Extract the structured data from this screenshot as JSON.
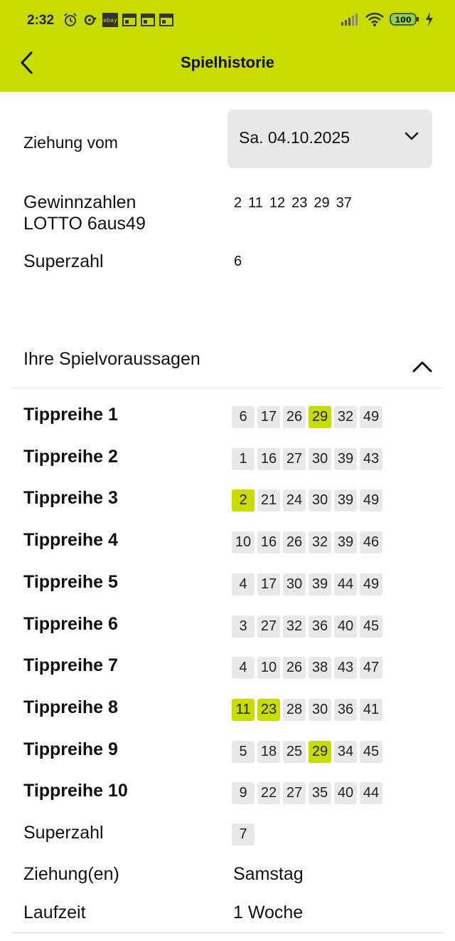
{
  "status_bar": {
    "time": "2:32",
    "battery": "100"
  },
  "app_bar": {
    "title": "Spielhistorie",
    "back_icon": "chevron-left-icon"
  },
  "draw": {
    "date_label": "Ziehung vom",
    "date_value": "Sa. 04.10.2025",
    "winning_label_line1": "Gewinnzahlen",
    "winning_label_line2": "LOTTO 6aus49",
    "winning_numbers": [
      "2",
      "11",
      "12",
      "23",
      "29",
      "37"
    ],
    "superzahl_label": "Superzahl",
    "superzahl_value": "6"
  },
  "predictions": {
    "title": "Ihre Spielvoraussagen",
    "rows": [
      {
        "label": "Tippreihe 1",
        "numbers": [
          "6",
          "17",
          "26",
          "29",
          "32",
          "49"
        ],
        "hits": [
          false,
          false,
          false,
          true,
          false,
          false
        ]
      },
      {
        "label": "Tippreihe 2",
        "numbers": [
          "1",
          "16",
          "27",
          "30",
          "39",
          "43"
        ],
        "hits": [
          false,
          false,
          false,
          false,
          false,
          false
        ]
      },
      {
        "label": "Tippreihe 3",
        "numbers": [
          "2",
          "21",
          "24",
          "30",
          "39",
          "49"
        ],
        "hits": [
          true,
          false,
          false,
          false,
          false,
          false
        ]
      },
      {
        "label": "Tippreihe 4",
        "numbers": [
          "10",
          "16",
          "26",
          "32",
          "39",
          "46"
        ],
        "hits": [
          false,
          false,
          false,
          false,
          false,
          false
        ]
      },
      {
        "label": "Tippreihe 5",
        "numbers": [
          "4",
          "17",
          "30",
          "39",
          "44",
          "49"
        ],
        "hits": [
          false,
          false,
          false,
          false,
          false,
          false
        ]
      },
      {
        "label": "Tippreihe 6",
        "numbers": [
          "3",
          "27",
          "32",
          "36",
          "40",
          "45"
        ],
        "hits": [
          false,
          false,
          false,
          false,
          false,
          false
        ]
      },
      {
        "label": "Tippreihe 7",
        "numbers": [
          "4",
          "10",
          "26",
          "38",
          "43",
          "47"
        ],
        "hits": [
          false,
          false,
          false,
          false,
          false,
          false
        ]
      },
      {
        "label": "Tippreihe 8",
        "numbers": [
          "11",
          "23",
          "28",
          "30",
          "36",
          "41"
        ],
        "hits": [
          true,
          true,
          false,
          false,
          false,
          false
        ]
      },
      {
        "label": "Tippreihe 9",
        "numbers": [
          "5",
          "18",
          "25",
          "29",
          "34",
          "45"
        ],
        "hits": [
          false,
          false,
          false,
          true,
          false,
          false
        ]
      },
      {
        "label": "Tippreihe 10",
        "numbers": [
          "9",
          "22",
          "27",
          "35",
          "40",
          "44"
        ],
        "hits": [
          false,
          false,
          false,
          false,
          false,
          false
        ]
      }
    ],
    "superzahl_label": "Superzahl",
    "superzahl_value": "7",
    "draws_label": "Ziehung(en)",
    "draws_value": "Samstag",
    "duration_label": "Laufzeit",
    "duration_value": "1 Woche"
  },
  "colors": {
    "accent": "#c8dc00",
    "chip_bg": "#e8e8e8"
  }
}
